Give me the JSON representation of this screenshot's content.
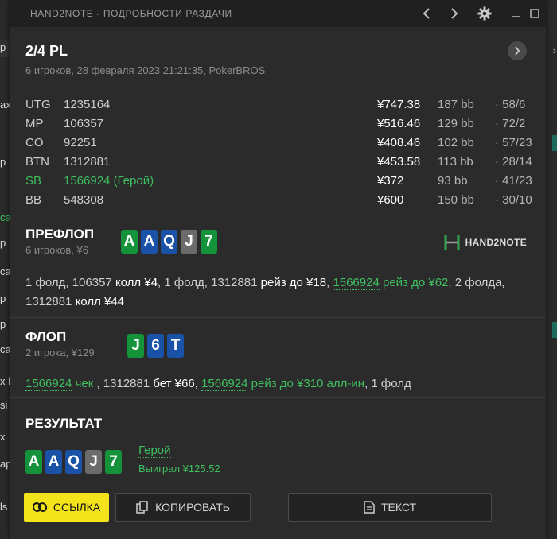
{
  "window": {
    "title": "HAND2NOTE - ПОДРОБНОСТИ РАЗДАЧИ"
  },
  "header": {
    "game": "2/4 PL",
    "subtitle": "6 игроков, 28 февраля 2023 21:21:35, PokerBROS"
  },
  "players": [
    {
      "pos": "UTG",
      "id": "1235164",
      "stack": "¥747.38",
      "bb": "187 bb",
      "stats": "· 58/6",
      "hero": false
    },
    {
      "pos": "MP",
      "id": "106357",
      "stack": "¥516.46",
      "bb": "129 bb",
      "stats": "· 72/2",
      "hero": false
    },
    {
      "pos": "CO",
      "id": "92251",
      "stack": "¥408.46",
      "bb": "102 bb",
      "stats": "· 57/23",
      "hero": false
    },
    {
      "pos": "BTN",
      "id": "1312881",
      "stack": "¥453.58",
      "bb": "113 bb",
      "stats": "· 28/14",
      "hero": false
    },
    {
      "pos": "SB",
      "id": "1566924 (Герой)",
      "stack": "¥372",
      "bb": "93 bb",
      "stats": "· 41/23",
      "hero": true
    },
    {
      "pos": "BB",
      "id": "548308",
      "stack": "¥600",
      "bb": "150 bb",
      "stats": "· 30/10",
      "hero": false
    }
  ],
  "preflop": {
    "title": "ПРЕФЛОП",
    "sub": "6 игроков, ¥6",
    "cards": [
      {
        "rank": "A",
        "color": "green"
      },
      {
        "rank": "A",
        "color": "blue"
      },
      {
        "rank": "Q",
        "color": "blue"
      },
      {
        "rank": "J",
        "color": "gray"
      },
      {
        "rank": "7",
        "color": "green"
      }
    ],
    "actions": [
      {
        "t": "1 фолд, 106357 ",
        "s": "n"
      },
      {
        "t": "колл ¥4",
        "s": "w"
      },
      {
        "t": ", 1 фолд, 1312881 ",
        "s": "n"
      },
      {
        "t": "рейз до ¥18",
        "s": "w"
      },
      {
        "t": ", ",
        "s": "n"
      },
      {
        "t": "1566924",
        "s": "gh"
      },
      {
        "t": " рейз до ¥62",
        "s": "g"
      },
      {
        "t": ", 2 фолда, 1312881 ",
        "s": "n"
      },
      {
        "t": "колл ¥44",
        "s": "w"
      }
    ]
  },
  "flop": {
    "title": "ФЛОП",
    "sub": "2 игрока, ¥129",
    "cards": [
      {
        "rank": "J",
        "color": "green"
      },
      {
        "rank": "6",
        "color": "blue"
      },
      {
        "rank": "T",
        "color": "blue"
      }
    ],
    "actions": [
      {
        "t": "1566924",
        "s": "gh"
      },
      {
        "t": " чек",
        "s": "g"
      },
      {
        "t": " , 1312881 ",
        "s": "n"
      },
      {
        "t": "бет ¥66",
        "s": "w"
      },
      {
        "t": ", ",
        "s": "n"
      },
      {
        "t": "1566924",
        "s": "gh"
      },
      {
        "t": " рейз до ¥310 алл-ин",
        "s": "g"
      },
      {
        "t": ", 1 фолд",
        "s": "n"
      }
    ]
  },
  "result": {
    "title": "РЕЗУЛЬТАТ",
    "cards": [
      {
        "rank": "A",
        "color": "green"
      },
      {
        "rank": "A",
        "color": "blue"
      },
      {
        "rank": "Q",
        "color": "blue"
      },
      {
        "rank": "J",
        "color": "gray"
      },
      {
        "rank": "7",
        "color": "green"
      }
    ],
    "hero_label": "Герой",
    "won": "Выиграл ¥125.52"
  },
  "logo": {
    "text": "HAND2NOTE"
  },
  "buttons": {
    "link": "ССЫЛКА",
    "copy": "КОПИРОВАТЬ",
    "text": "ТЕКСТ"
  },
  "background_fragments": [
    "p",
    "ax",
    "p",
    "ca",
    "p",
    "ca",
    "p",
    "p",
    "ca",
    "x l",
    "si",
    "x",
    "ap",
    "ls"
  ],
  "colors": {
    "hero_green": "#3fc060",
    "card_green": "#15933a",
    "card_blue": "#1a52a8",
    "card_gray": "#6b6b6b",
    "link_button": "#f2e31b"
  }
}
